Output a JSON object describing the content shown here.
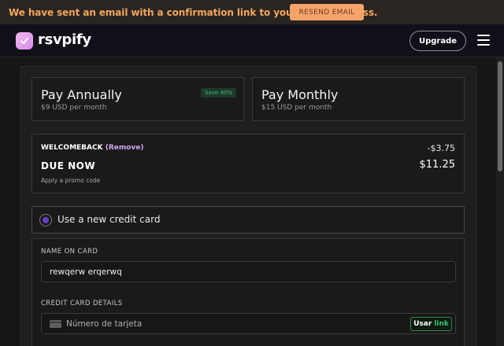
{
  "banner": {
    "message": "We have sent an email with a confirmation link to your email address.",
    "resend_label": "RESEND EMAIL"
  },
  "nav": {
    "brand": "rsvpify",
    "upgrade_label": "Upgrade"
  },
  "plans": [
    {
      "title": "Pay Annually",
      "price": "$9 USD per month",
      "badge": "Save 40%"
    },
    {
      "title": "Pay Monthly",
      "price": "$15 USD per month"
    }
  ],
  "summary": {
    "promo_code": "WELCOMEBACK",
    "remove_label": "(Remove)",
    "discount": "-$3.75",
    "due_label": "DUE NOW",
    "due_amount": "$11.25",
    "apply_promo": "Apply a promo code"
  },
  "payment": {
    "new_card_label": "Use a new credit card",
    "name_label": "NAME ON CARD",
    "name_value": "rewqerw erqerwq",
    "card_label": "CREDIT CARD DETAILS",
    "card_placeholder": "Número de tarjeta",
    "link_prefix": "Usar",
    "link_word": "link"
  },
  "colors": {
    "banner_text": "#f2a65e",
    "resend_bg": "#f6a36a",
    "accent_purple": "#6a3cc8",
    "link_green": "#36c46f",
    "save_green": "#3fb87a"
  }
}
